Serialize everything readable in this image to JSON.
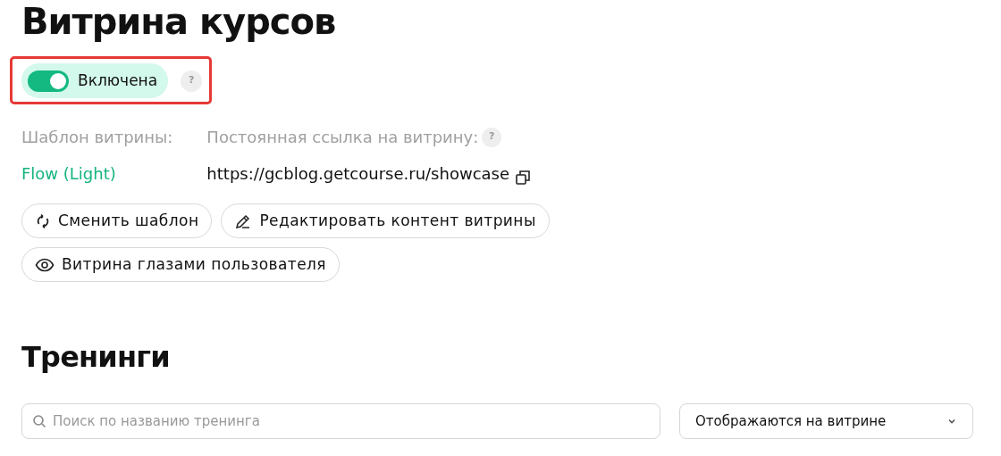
{
  "title": "Витрина курсов",
  "toggle": {
    "label": "Включена",
    "on": true,
    "help": "?"
  },
  "template": {
    "label": "Шаблон витрины:",
    "value": "Flow (Light)"
  },
  "link": {
    "label": "Постоянная ссылка на витрину:",
    "help": "?",
    "value": "https://gcblog.getcourse.ru/showcase"
  },
  "actions": [
    {
      "label": "Сменить шаблон",
      "kind": "change"
    },
    {
      "label": "Редактировать контент витрины",
      "kind": "edit"
    },
    {
      "label": "Витрина глазами пользователя",
      "kind": "preview"
    }
  ],
  "section": {
    "title": "Тренинги",
    "search": {
      "placeholder": "Поиск по названию тренинга"
    },
    "filter": {
      "value": "Отображаются на витрине"
    }
  }
}
